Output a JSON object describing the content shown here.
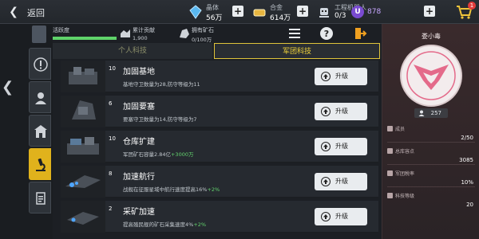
{
  "topbar": {
    "back_label": "返回",
    "resources": [
      {
        "name": "晶体",
        "value": "56万"
      },
      {
        "name": "合金",
        "value": "614万"
      },
      {
        "name": "工程机器人",
        "value": "0/3"
      }
    ],
    "premium_value": "878",
    "premium_icon_letter": "U",
    "cart_badge": "1"
  },
  "player": {
    "activity_label": "活跃度",
    "activity_fraction": 1.0,
    "contribution_label": "累计贡献",
    "contribution_value": "1,900",
    "ore_label": "拥有矿石",
    "ore_value": "0/100万"
  },
  "tabs": [
    {
      "label": "个人科技",
      "active": false
    },
    {
      "label": "军团科技",
      "active": true
    }
  ],
  "techs": [
    {
      "level": "10",
      "title": "加固基地",
      "desc": "基地守卫数量为28,防守等级为11",
      "bonus": "",
      "upgrade_label": "升级"
    },
    {
      "level": "6",
      "title": "加固要塞",
      "desc": "要塞守卫数量为14,防守等级为7",
      "bonus": "",
      "upgrade_label": "升级"
    },
    {
      "level": "10",
      "title": "仓库扩建",
      "desc": "军团矿石容量2.84亿",
      "bonus": "+3000万",
      "upgrade_label": "升级"
    },
    {
      "level": "8",
      "title": "加速航行",
      "desc": "战舰在征服星域中航行速度提高16%",
      "bonus": "+2%",
      "upgrade_label": "升级"
    },
    {
      "level": "2",
      "title": "采矿加速",
      "desc": "提高殖民舰的矿石采集速度4%",
      "bonus": "+2%",
      "upgrade_label": "升级"
    }
  ],
  "legion": {
    "name": "娄小毒",
    "member_count": "257",
    "stats": [
      {
        "label": "成员",
        "value": "2/50"
      },
      {
        "label": "总库容点",
        "value": "3085"
      },
      {
        "label": "军团税率",
        "value": "10%"
      },
      {
        "label": "科技等级",
        "value": "20"
      }
    ]
  },
  "colors": {
    "accent_yellow": "#e0b21c",
    "bonus_green": "#63d46e",
    "emblem_pink": "#e46a8a"
  }
}
